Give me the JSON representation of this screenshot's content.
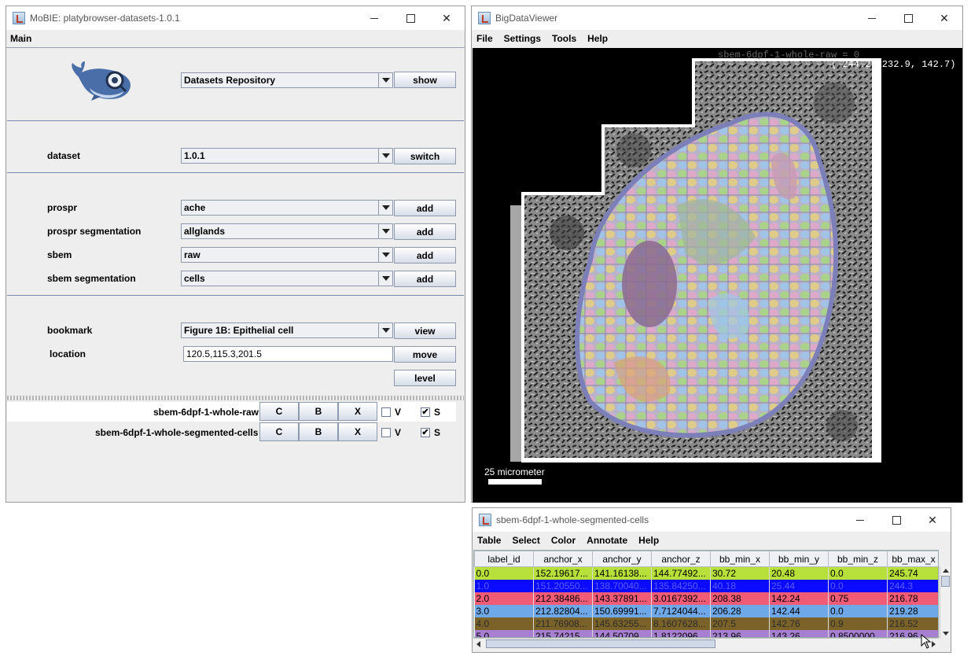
{
  "mobie": {
    "title": "MoBIE: platybrowser-datasets-1.0.1",
    "menu": "Main",
    "source_value": "Datasets Repository",
    "show_label": "show",
    "dataset_label": "dataset",
    "dataset_value": "1.0.1",
    "switch_label": "switch",
    "rows": [
      {
        "label": "prospr",
        "value": "ache",
        "button": "add"
      },
      {
        "label": "prospr segmentation",
        "value": "allglands",
        "button": "add"
      },
      {
        "label": "sbem",
        "value": "raw",
        "button": "add"
      },
      {
        "label": "sbem segmentation",
        "value": "cells",
        "button": "add"
      }
    ],
    "bookmark_label": "bookmark",
    "bookmark_value": "Figure 1B: Epithelial cell",
    "view_label": "view",
    "location_label": "location",
    "location_value": "120.5,115.3,201.5",
    "move_label": "move",
    "level_label": "level",
    "layers": [
      {
        "name": "sbem-6dpf-1-whole-raw",
        "c": "C",
        "b": "B",
        "x": "X",
        "v": "V",
        "s": "S",
        "v_checked": false,
        "s_checked": true
      },
      {
        "name": "sbem-6dpf-1-whole-segmented-cells",
        "c": "C",
        "b": "B",
        "x": "X",
        "v": "V",
        "s": "S",
        "v_checked": false,
        "s_checked": true
      }
    ]
  },
  "bdv": {
    "title": "BigDataViewer",
    "menu": [
      "File",
      "Settings",
      "Tools",
      "Help"
    ],
    "source_name": "sbem-6dpf-1-whole-raw = 0",
    "coords": "( 244.2, 232.9, 142.7)",
    "scale_label": "25 micrometer"
  },
  "table": {
    "title": "sbem-6dpf-1-whole-segmented-cells",
    "menu": [
      "Table",
      "Select",
      "Color",
      "Annotate",
      "Help"
    ],
    "columns": [
      "label_id",
      "anchor_x",
      "anchor_y",
      "anchor_z",
      "bb_min_x",
      "bb_min_y",
      "bb_min_z",
      "bb_max_x"
    ],
    "rows": [
      {
        "color": "#b8e03a",
        "text": "#000000",
        "cells": [
          "0.0",
          "152.19617...",
          "141.16138...",
          "144.77492...",
          "30.72",
          "20.48",
          "0.0",
          "245.74"
        ]
      },
      {
        "color": "#0a0aff",
        "text": "#5a5aff",
        "cells": [
          "1.0",
          "151.20550...",
          "138.70040...",
          "135.84250...",
          "40.18",
          "25.44",
          "0.0",
          "244.3"
        ]
      },
      {
        "color": "#f25b76",
        "text": "#000000",
        "cells": [
          "2.0",
          "212.38486...",
          "143.37891...",
          "3.0167392...",
          "208.38",
          "142.24",
          "0.75",
          "216.78"
        ]
      },
      {
        "color": "#6fa8e8",
        "text": "#000000",
        "cells": [
          "3.0",
          "212.82804...",
          "150.69991...",
          "7.7124044...",
          "206.28",
          "142.44",
          "0.0",
          "219.28"
        ]
      },
      {
        "color": "#7a6229",
        "text": "#2b2b2b",
        "cells": [
          "4.0",
          "211.76908...",
          "145.63255...",
          "8.1607628...",
          "207.5",
          "142.76",
          "0.9",
          "216.52"
        ]
      },
      {
        "color": "#a77fd1",
        "text": "#000000",
        "cells": [
          "5.0",
          "215.74215...",
          "144.50709...",
          "1.8122096...",
          "213.96",
          "143.26",
          "0.8500000...",
          "216.96"
        ]
      }
    ]
  }
}
